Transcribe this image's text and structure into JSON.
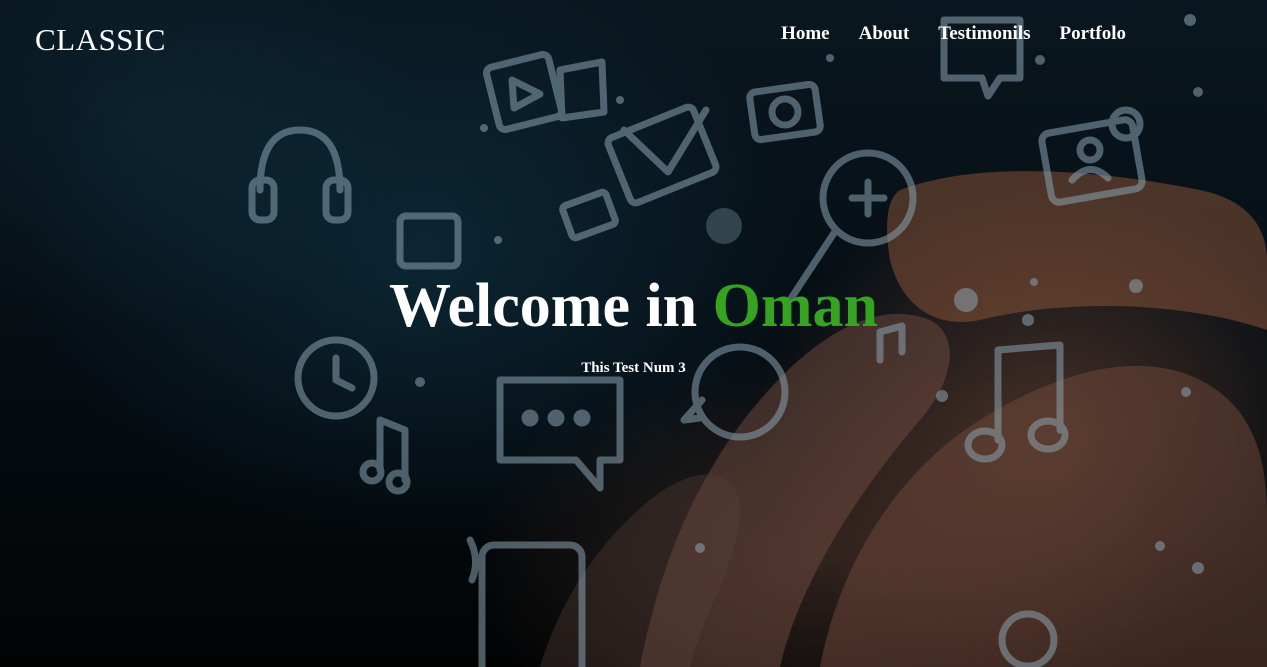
{
  "navbar": {
    "brand": "CLASSIC",
    "links": [
      {
        "label": "Home"
      },
      {
        "label": "About"
      },
      {
        "label": "Testimonils"
      },
      {
        "label": "Portfolo"
      }
    ]
  },
  "hero": {
    "title_part1": "Welcome in",
    "title_accent": "Oman",
    "subtitle": "This Test Num 3",
    "accent_color": "#36a420",
    "background": "dark photo of a hand touching glowing social media icons"
  }
}
